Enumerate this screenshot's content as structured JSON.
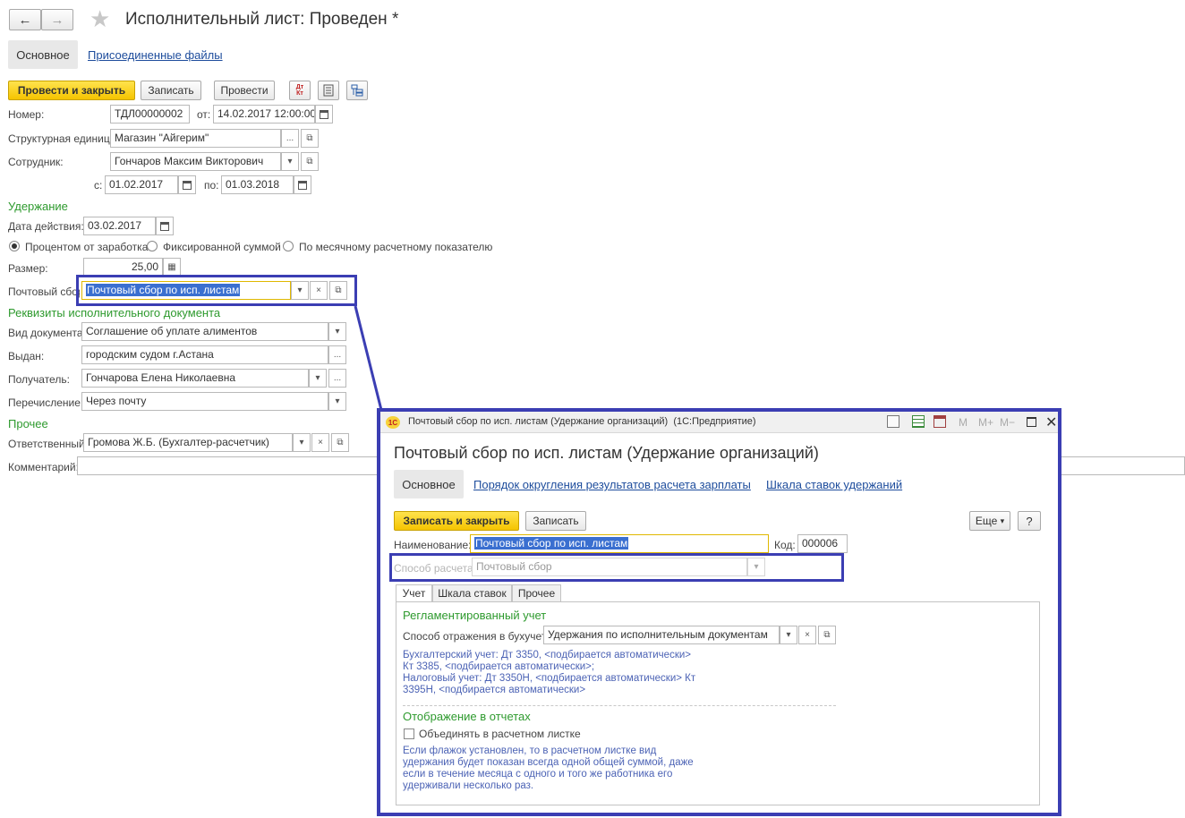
{
  "main": {
    "title": "Исполнительный лист: Проведен *",
    "tabs": [
      "Основное",
      "Присоединенные файлы"
    ],
    "toolbar": {
      "post_close": "Провести и закрыть",
      "save": "Записать",
      "post": "Провести",
      "dtkt_icon_text": "Дт Кт"
    },
    "number_label": "Номер:",
    "number_value": "ТДЛ00000002",
    "from_label": "от:",
    "from_value": "14.02.2017 12:00:00",
    "unit_label": "Структурная единица:",
    "unit_value": "Магазин \"Айгерим\"",
    "employee_label": "Сотрудник:",
    "employee_value": "Гончаров Максим Викторович",
    "period_from_label": "с:",
    "period_from_value": "01.02.2017",
    "period_to_label": "по:",
    "period_to_value": "01.03.2018",
    "section_deduction": "Удержание",
    "action_date_label": "Дата действия:",
    "action_date_value": "03.02.2017",
    "radio_options": [
      "Процентом от заработка",
      "Фиксированной суммой",
      "По месячному расчетному показателю"
    ],
    "size_label": "Размер:",
    "size_value": "25,00",
    "postal_label": "Почтовый сбор:",
    "postal_value": "Почтовый сбор по исп. листам",
    "section_doc": "Реквизиты исполнительного документа",
    "doc_type_label": "Вид документа:",
    "doc_type_value": "Соглашение об уплате алиментов",
    "issued_label": "Выдан:",
    "issued_value": "городским судом г.Астана",
    "recipient_label": "Получатель:",
    "recipient_value": "Гончарова Елена Николаевна",
    "transfer_label": "Перечисление:",
    "transfer_value": "Через почту",
    "section_other": "Прочее",
    "responsible_label": "Ответственный:",
    "responsible_value": "Громова Ж.Б. (Бухгалтер-расчетчик)",
    "comment_label": "Комментарий:",
    "comment_value": ""
  },
  "dialog": {
    "window_title": "Почтовый сбор по исп. листам (Удержание организаций)  (1С:Предприятие)",
    "logo_text": "1С",
    "win_buttons": [
      "M",
      "M+",
      "M−"
    ],
    "title": "Почтовый сбор по исп. листам (Удержание организаций)",
    "tabs": [
      "Основное",
      "Порядок округления результатов расчета зарплаты",
      "Шкала ставок удержаний"
    ],
    "save_close": "Записать и закрыть",
    "save": "Записать",
    "more": "Еще",
    "help": "?",
    "name_label": "Наименование:",
    "name_value": "Почтовый сбор по исп. листам",
    "code_label": "Код:",
    "code_value": "000006",
    "method_label": "Способ расчета:",
    "method_value": "Почтовый сбор",
    "inner_tabs": [
      "Учет",
      "Шкала ставок",
      "Прочее"
    ],
    "section_reg": "Регламентированный учет",
    "reflect_label": "Способ отражения в бухучете:",
    "reflect_value": "Удержания по исполнительным документам",
    "acc_lines": [
      "Бухгалтерский учет: Дт 3350, <подбирается автоматически>",
      "Кт 3385, <подбирается автоматически>;",
      "Налоговый учет: Дт 3350Н, <подбирается автоматически> Кт",
      "3395Н, <подбирается автоматически>"
    ],
    "section_reports": "Отображение в отчетах",
    "combine_label": "Объединять в расчетном листке",
    "note_lines": [
      "Если флажок установлен, то в расчетном листке вид",
      "удержания будет показан всегда одной общей суммой, даже",
      "если в течение месяца с одного и того же работника его",
      "удерживали несколько раз."
    ]
  },
  "colors": {
    "accent_yellow": "#f5c400",
    "section_green": "#2e9a2e",
    "link_blue": "#1d4c9c",
    "frame_blue": "#3b3eb3",
    "info_blue": "#4c63b5",
    "selection": "#3a6fd0"
  }
}
